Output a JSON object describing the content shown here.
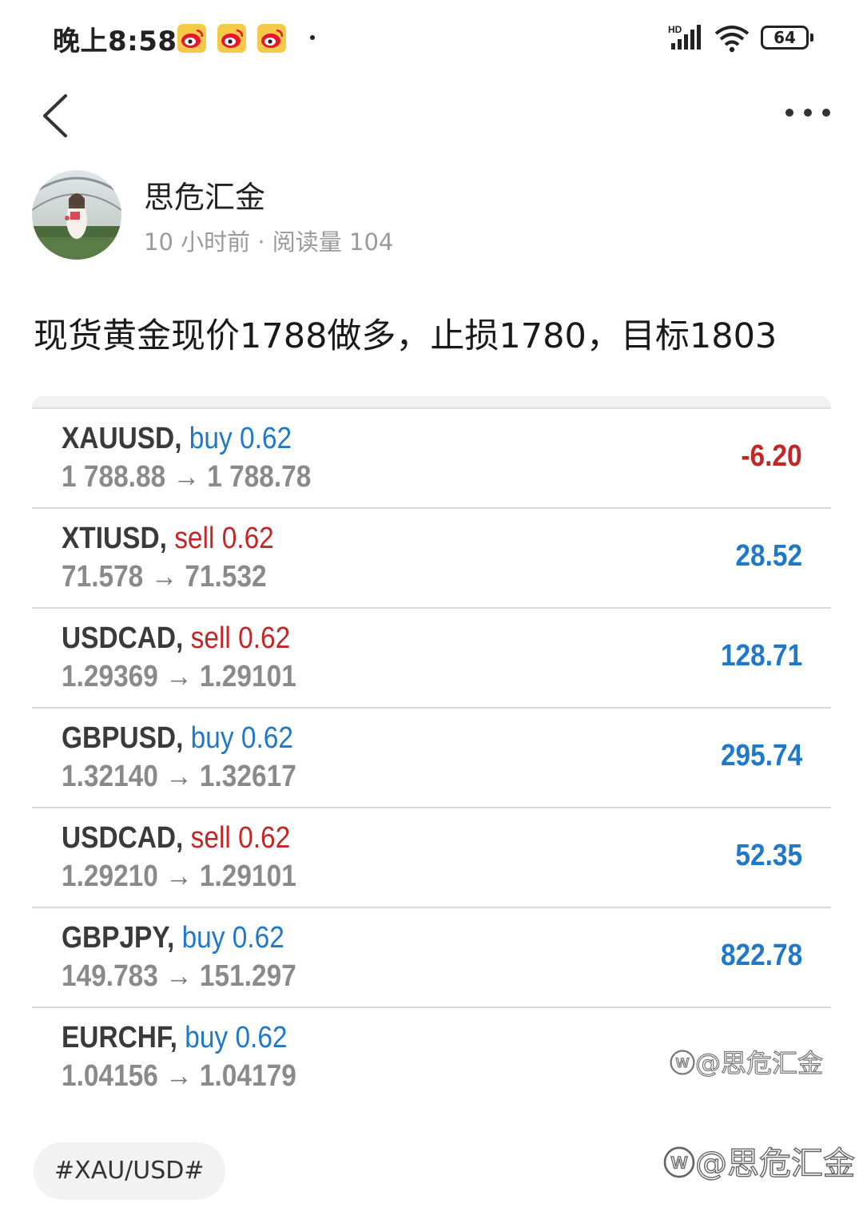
{
  "status_bar": {
    "time": "晚上8:58",
    "network": "HD",
    "battery": "64",
    "notification_icons": [
      "weibo-icon",
      "weibo-icon",
      "weibo-icon"
    ]
  },
  "nav": {
    "back_icon": "chevron-left-icon",
    "more_icon": "more-horizontal-icon"
  },
  "author": {
    "name": "思危汇金",
    "meta": "10 小时前 · 阅读量 104"
  },
  "post": {
    "text": "现货黄金现价1788做多，止损1780，目标1803"
  },
  "trades": [
    {
      "symbol": "XAUUSD,",
      "side": "buy",
      "volume": "0.62",
      "open": "1 788.88",
      "close": "1 788.78",
      "profit": "-6.20"
    },
    {
      "symbol": "XTIUSD,",
      "side": "sell",
      "volume": "0.62",
      "open": "71.578",
      "close": "71.532",
      "profit": "28.52"
    },
    {
      "symbol": "USDCAD,",
      "side": "sell",
      "volume": "0.62",
      "open": "1.29369",
      "close": "1.29101",
      "profit": "128.71"
    },
    {
      "symbol": "GBPUSD,",
      "side": "buy",
      "volume": "0.62",
      "open": "1.32140",
      "close": "1.32617",
      "profit": "295.74"
    },
    {
      "symbol": "USDCAD,",
      "side": "sell",
      "volume": "0.62",
      "open": "1.29210",
      "close": "1.29101",
      "profit": "52.35"
    },
    {
      "symbol": "GBPJPY,",
      "side": "buy",
      "volume": "0.62",
      "open": "149.783",
      "close": "151.297",
      "profit": "822.78"
    },
    {
      "symbol": "EURCHF,",
      "side": "buy",
      "volume": "0.62",
      "open": "1.04156",
      "close": "1.04179",
      "profit": ""
    }
  ],
  "arrow_glyph": "→",
  "watermark_inner": "@思危汇金",
  "watermark_page": "@思危汇金",
  "hashtag": "#XAU/USD#",
  "colors": {
    "buy": "#1f78c8",
    "sell": "#c22626",
    "positive_profit": "#1f78c8",
    "negative_profit": "#c22626",
    "price_text": "#8a8a8a",
    "symbol_text": "#3a3a3a"
  }
}
